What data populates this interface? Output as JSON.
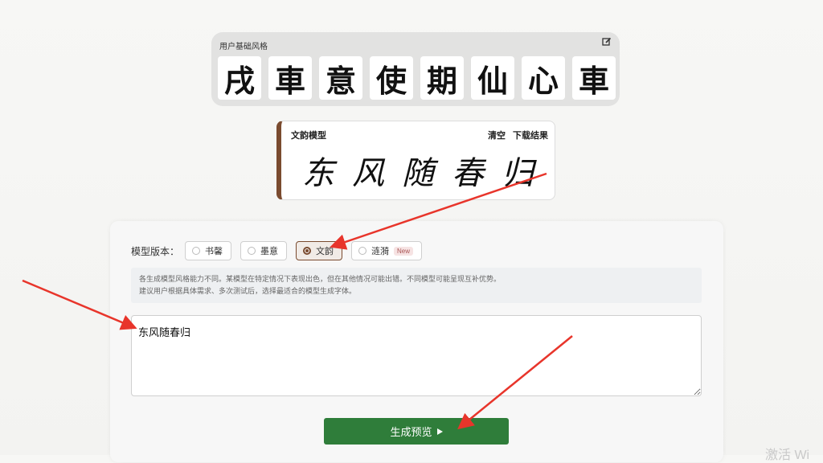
{
  "style_card": {
    "title": "用户基础风格",
    "edit_icon": "edit-icon",
    "glyphs": [
      "戌",
      "車",
      "意",
      "使",
      "期",
      "仙",
      "心",
      "車"
    ]
  },
  "result_card": {
    "title": "文韵模型",
    "clear_label": "清空",
    "download_label": "下载结果",
    "glyphs": [
      "东",
      "风",
      "随",
      "春",
      "归"
    ]
  },
  "panel": {
    "version_label": "模型版本：",
    "options": [
      {
        "label": "书馨",
        "selected": false
      },
      {
        "label": "墨意",
        "selected": false
      },
      {
        "label": "文韵",
        "selected": true
      },
      {
        "label": "涟漪",
        "selected": false,
        "badge": "New"
      }
    ],
    "notice_lines": [
      "各生成模型风格能力不同。某模型在特定情况下表现出色，但在其他情况可能出错。不同模型可能呈现互补优势。",
      "建议用户根据具体需求、多次测试后，选择最适合的模型生成字体。"
    ],
    "input_value": "东风随春归",
    "generate_label": "生成预览",
    "play_icon": "play-icon"
  },
  "watermark": "激活 Wi",
  "colors": {
    "accent_brown": "#7a4b2f",
    "button_green": "#2f7d3a",
    "annotation_red": "#e8352b"
  }
}
